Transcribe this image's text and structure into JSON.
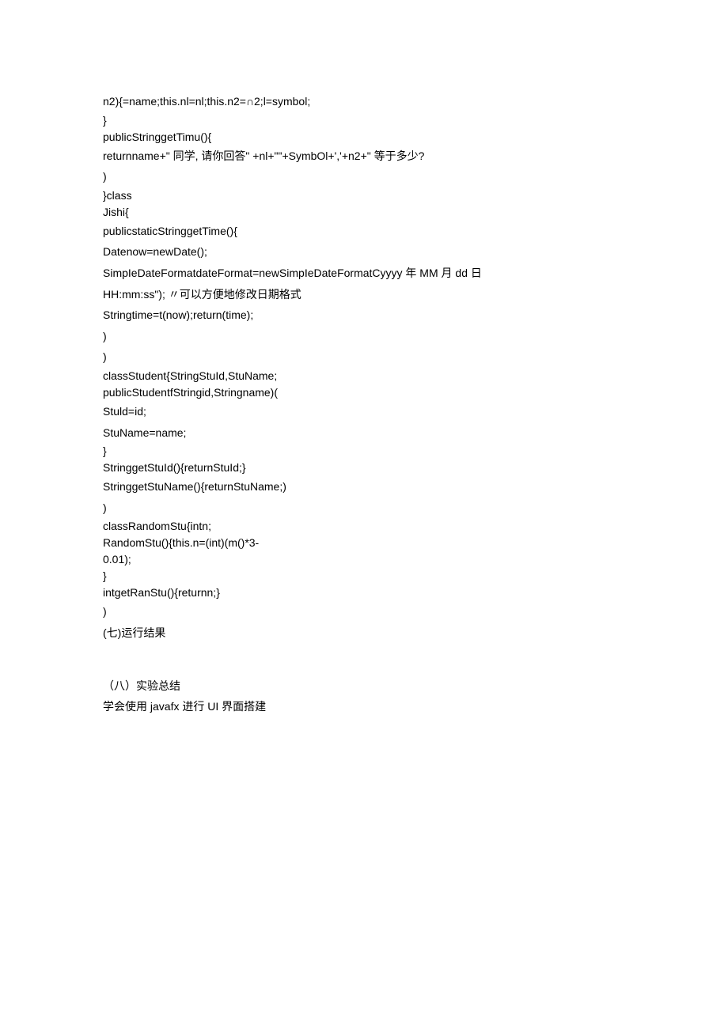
{
  "lines": [
    {
      "text": "n2){=name;this.nl=nl;this.n2=∩2;l=symbol;",
      "cls": "line"
    },
    {
      "text": "}\npublicStringgetTimu(){",
      "cls": "line tight"
    },
    {
      "text": "returnname+\" 同学, 请你回答\" +nl+\"\"+SymbOl+','+n2+\" 等于多少?",
      "cls": "line"
    },
    {
      "text": ")",
      "cls": "line"
    },
    {
      "text": "}class\nJishi{",
      "cls": "line tight"
    },
    {
      "text": "publicstaticStringgetTime(){",
      "cls": "line"
    },
    {
      "text": "Datenow=newDate();",
      "cls": "line"
    },
    {
      "text": "SimpIeDateFormatdateFormat=newSimpIeDateFormatCyyyy 年 MM 月 dd 日",
      "cls": "line"
    },
    {
      "text": "HH:mm:ss\"); 〃可以方便地修改日期格式",
      "cls": "line"
    },
    {
      "text": "Stringtime=t(now);return(time);",
      "cls": "line"
    },
    {
      "text": ")",
      "cls": "line"
    },
    {
      "text": ")",
      "cls": "line"
    },
    {
      "text": "classStudent{StringStuId,StuName;\npublicStudentfStringid,Stringname)(",
      "cls": "line tight"
    },
    {
      "text": "Stuld=id;",
      "cls": "line"
    },
    {
      "text": "StuName=name;",
      "cls": "line"
    },
    {
      "text": "}\nStringgetStuId(){returnStuId;}",
      "cls": "line tight"
    },
    {
      "text": "StringgetStuName(){returnStuName;)",
      "cls": "line"
    },
    {
      "text": ")",
      "cls": "line"
    },
    {
      "text": "classRandomStu{intn;\nRandomStu(){this.n=(int)(m()*3-\n0.01);",
      "cls": "line tight"
    },
    {
      "text": "}\nintgetRanStu(){returnn;}",
      "cls": "line tight"
    },
    {
      "text": ")",
      "cls": "line"
    },
    {
      "text": "(七)运行结果",
      "cls": "line"
    },
    {
      "text": "（八）实验总结",
      "cls": "line gap-before"
    },
    {
      "text": "学会使用 javafx 进行 UI 界面搭建",
      "cls": "line"
    }
  ]
}
